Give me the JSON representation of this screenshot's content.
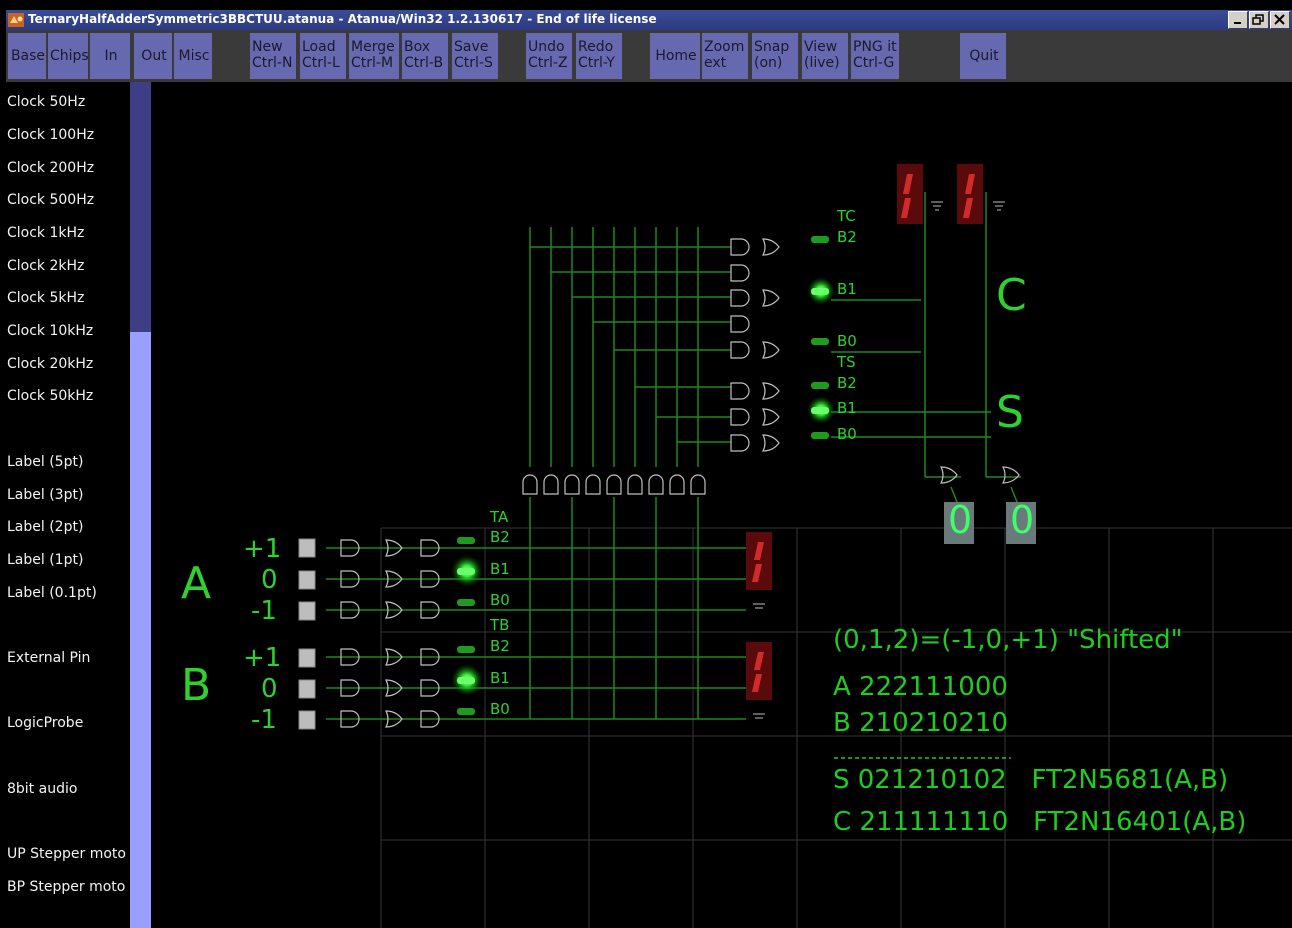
{
  "window": {
    "title": "TernaryHalfAdderSymmetric3BBCTUU.atanua - Atanua/Win32 1.2.130617 - End of life license"
  },
  "toolbar": {
    "buttons": [
      {
        "l1": "Base",
        "l2": ""
      },
      {
        "l1": "Chips",
        "l2": ""
      },
      {
        "l1": "In",
        "l2": ""
      },
      {
        "l1": "Out",
        "l2": ""
      },
      {
        "l1": "Misc",
        "l2": ""
      },
      {
        "l1": "New",
        "l2": "Ctrl-N"
      },
      {
        "l1": "Load",
        "l2": "Ctrl-L"
      },
      {
        "l1": "Merge",
        "l2": "Ctrl-M"
      },
      {
        "l1": "Box",
        "l2": "Ctrl-B"
      },
      {
        "l1": "Save",
        "l2": "Ctrl-S"
      },
      {
        "l1": "Undo",
        "l2": "Ctrl-Z"
      },
      {
        "l1": "Redo",
        "l2": "Ctrl-Y"
      },
      {
        "l1": "Home",
        "l2": ""
      },
      {
        "l1": "Zoom",
        "l2": "ext"
      },
      {
        "l1": "Snap",
        "l2": "(on)"
      },
      {
        "l1": "View",
        "l2": "(live)"
      },
      {
        "l1": "PNG it",
        "l2": "Ctrl-G"
      },
      {
        "l1": "Quit",
        "l2": ""
      }
    ]
  },
  "sidebar": {
    "items": [
      "Clock 50Hz",
      "Clock 100Hz",
      "Clock 200Hz",
      "Clock 500Hz",
      "Clock 1kHz",
      "Clock 2kHz",
      "Clock 5kHz",
      "Clock 10kHz",
      "Clock 20kHz",
      "Clock 50kHz",
      "Label (5pt)",
      "Label (3pt)",
      "Label (2pt)",
      "Label (1pt)",
      "Label (0.1pt)",
      "External Pin",
      "LogicProbe",
      "8bit audio",
      "UP Stepper moto",
      "BP Stepper moto"
    ]
  },
  "canvas": {
    "inputs": {
      "a": "A",
      "b": "B",
      "p1": "+1",
      "z": "0",
      "m1": "-1"
    },
    "bus": {
      "ta": "TA",
      "tb": "TB",
      "tc": "TC",
      "ts": "TS",
      "b2": "B2",
      "b1": "B1",
      "b0": "B0"
    },
    "outputs": {
      "c": "C",
      "s": "S",
      "c_digit": "0",
      "s_digit": "0"
    },
    "notes": {
      "line1": "(0,1,2)=(-1,0,+1) \"Shifted\"",
      "line2": "A 222111000",
      "line3": "B 210210210",
      "line4": "S 021210102   FT2N5681(A,B)",
      "line5": "C 211111110   FT2N16401(A,B)"
    },
    "colors": {
      "wire": "#1b8a1b",
      "text": "#2fd12f",
      "led_on": "#6bff6b",
      "segment": "#8b1010"
    }
  }
}
